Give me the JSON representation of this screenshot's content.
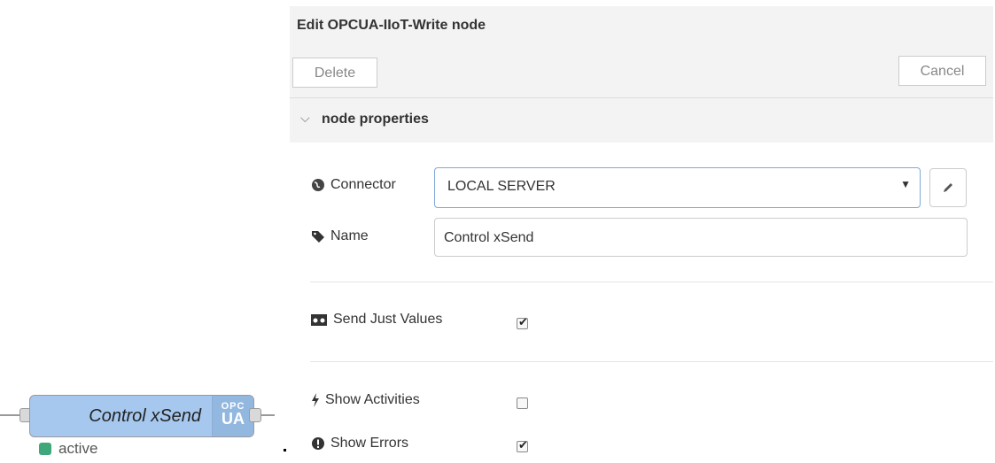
{
  "node": {
    "label": "Control xSend",
    "icon_top": "OPC",
    "icon_bottom": "UA",
    "status": "active",
    "status_color": "#3ea87a",
    "fill_color": "#a6c8ee"
  },
  "panel": {
    "title": "Edit OPCUA-IIoT-Write node",
    "delete_label": "Delete",
    "cancel_label": "Cancel",
    "section_title": "node properties",
    "section_icon": "chevron-down-icon"
  },
  "fields": {
    "connector_label": "Connector",
    "connector_icon": "globe-icon",
    "connector_value": "LOCAL SERVER",
    "name_label": "Name",
    "name_icon": "tag-icon",
    "name_value": "Control xSend",
    "edit_icon": "pencil-icon"
  },
  "options": [
    {
      "label": "Send Just Values",
      "icon": "values-icon",
      "checked": true
    },
    {
      "label": "Show Activities",
      "icon": "bolt-icon",
      "checked": false
    },
    {
      "label": "Show Errors",
      "icon": "exclamation-icon",
      "checked": true
    }
  ]
}
